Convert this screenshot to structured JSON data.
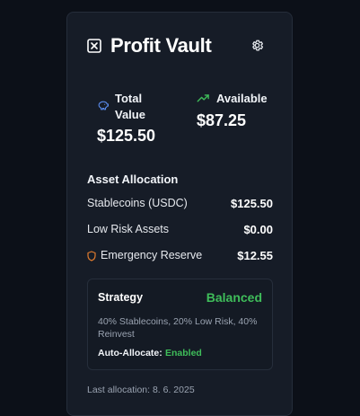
{
  "header": {
    "title": "Profit Vault",
    "vault_icon": "close-box-icon",
    "settings_icon": "gear-icon"
  },
  "stats": {
    "total": {
      "label": "Total Value",
      "value": "$125.50",
      "icon": "piggy-bank-icon",
      "icon_color": "#5b8def"
    },
    "available": {
      "label": "Available",
      "value": "$87.25",
      "icon": "trending-up-icon",
      "icon_color": "#3fbd5a"
    }
  },
  "allocation": {
    "title": "Asset Allocation",
    "rows": [
      {
        "name": "Stablecoins (USDC)",
        "value": "$125.50"
      },
      {
        "name": "Low Risk Assets",
        "value": "$0.00"
      },
      {
        "name": "Emergency Reserve",
        "value": "$12.55",
        "icon": "shield-icon",
        "icon_color": "#e07b2e"
      }
    ]
  },
  "strategy": {
    "title": "Strategy",
    "mode": "Balanced",
    "description": "40% Stablecoins, 20% Low Risk, 40% Reinvest",
    "auto_label": "Auto-Allocate:",
    "auto_value": "Enabled",
    "accent": "#3fbd5a"
  },
  "footer": {
    "last_allocation": "Last allocation: 8. 6. 2025"
  }
}
